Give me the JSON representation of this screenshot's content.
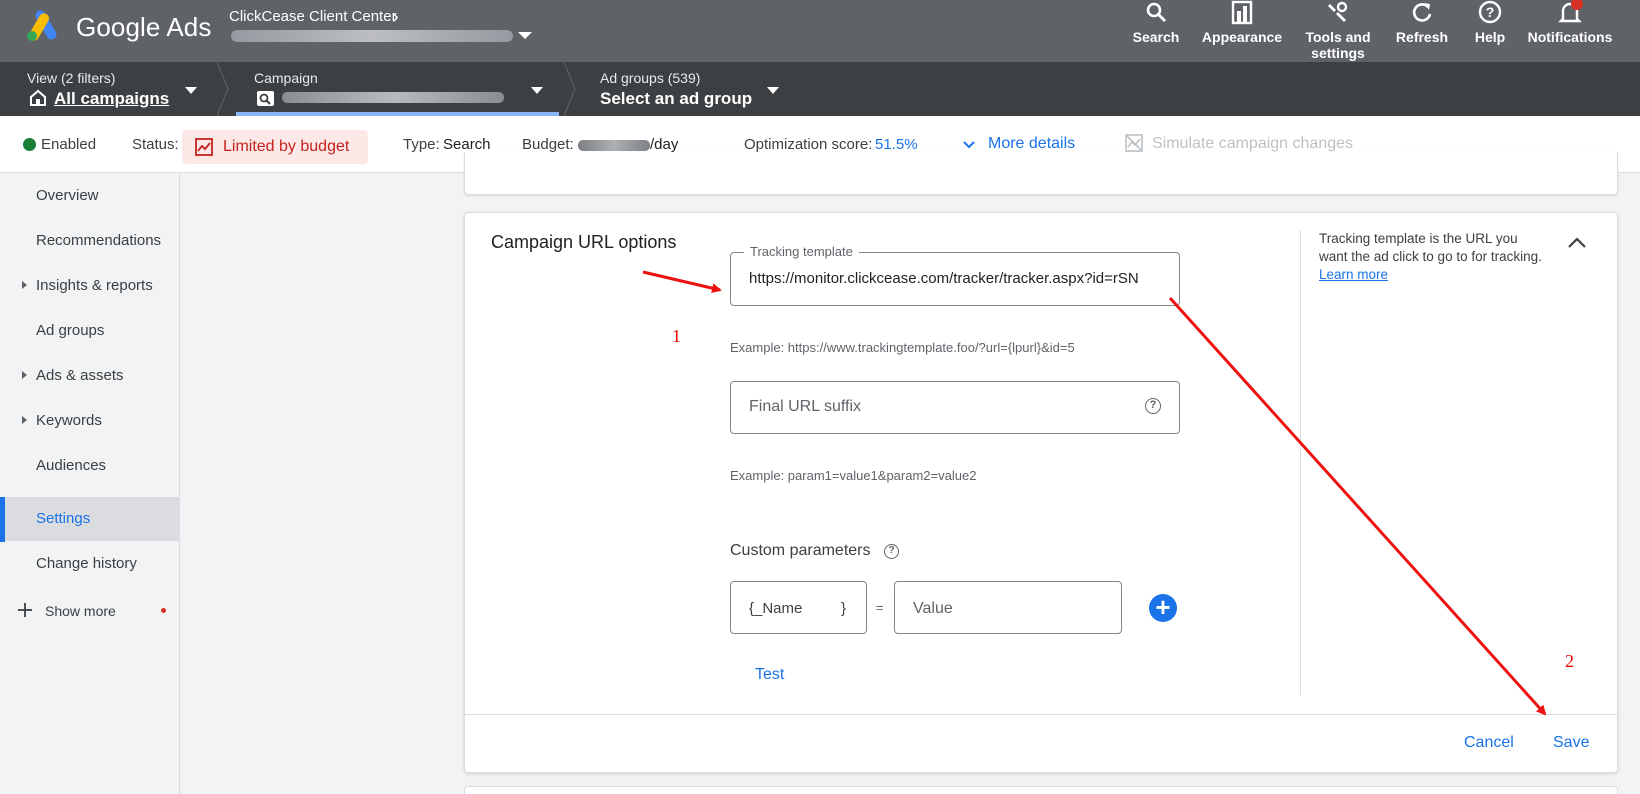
{
  "header": {
    "brand": "Google Ads",
    "client_center": "ClickCease Client Center",
    "buttons": {
      "search": "Search",
      "appearance": "Appearance",
      "tools_line1": "Tools and",
      "tools_line2": "settings",
      "refresh": "Refresh",
      "help": "Help",
      "notifications": "Notifications"
    }
  },
  "navbar": {
    "view_label": "View (2 filters)",
    "view_value": "All campaigns",
    "campaign_label": "Campaign",
    "adgroups_label": "Ad groups (539)",
    "adgroups_value": "Select an ad group"
  },
  "statusbar": {
    "enabled": "Enabled",
    "status_label": "Status:",
    "status_value": "Limited by budget",
    "type_label": "Type:",
    "type_value": "Search",
    "budget_label": "Budget:",
    "budget_suffix": "/day",
    "opt_label": "Optimization score:",
    "opt_value": "51.5%",
    "more_details": "More details",
    "simulate": "Simulate campaign changes"
  },
  "sidebar": {
    "items": [
      {
        "label": "Overview"
      },
      {
        "label": "Recommendations"
      },
      {
        "label": "Insights & reports"
      },
      {
        "label": "Ad groups"
      },
      {
        "label": "Ads & assets"
      },
      {
        "label": "Keywords"
      },
      {
        "label": "Audiences"
      },
      {
        "label": "Settings"
      },
      {
        "label": "Change history"
      }
    ],
    "show_more": "Show more"
  },
  "card": {
    "title": "Campaign URL options",
    "tracking_legend": "Tracking template",
    "tracking_value": "https://monitor.clickcease.com/tracker/tracker.aspx?id=rSN",
    "tracking_example": "Example: https://www.trackingtemplate.foo/?url={lpurl}&id=5",
    "final_url_placeholder": "Final URL suffix",
    "final_url_example": "Example: param1=value1&param2=value2",
    "custom_params_label": "Custom parameters",
    "name_prefix": "{_Name",
    "name_suffix": "}",
    "equals": "=",
    "value_placeholder": "Value",
    "test": "Test",
    "help_text": "Tracking template is the URL you want the ad click to go to for tracking.",
    "learn_more": "Learn more",
    "cancel": "Cancel",
    "save": "Save"
  },
  "annotations": {
    "step1": "1",
    "step2": "2"
  },
  "colors": {
    "topbar": "#5f6368",
    "navbar": "#3c4043",
    "accent": "#1a73e8",
    "enabled": "#188038",
    "limited": "#c5221f",
    "annotation": "#ee0000"
  }
}
